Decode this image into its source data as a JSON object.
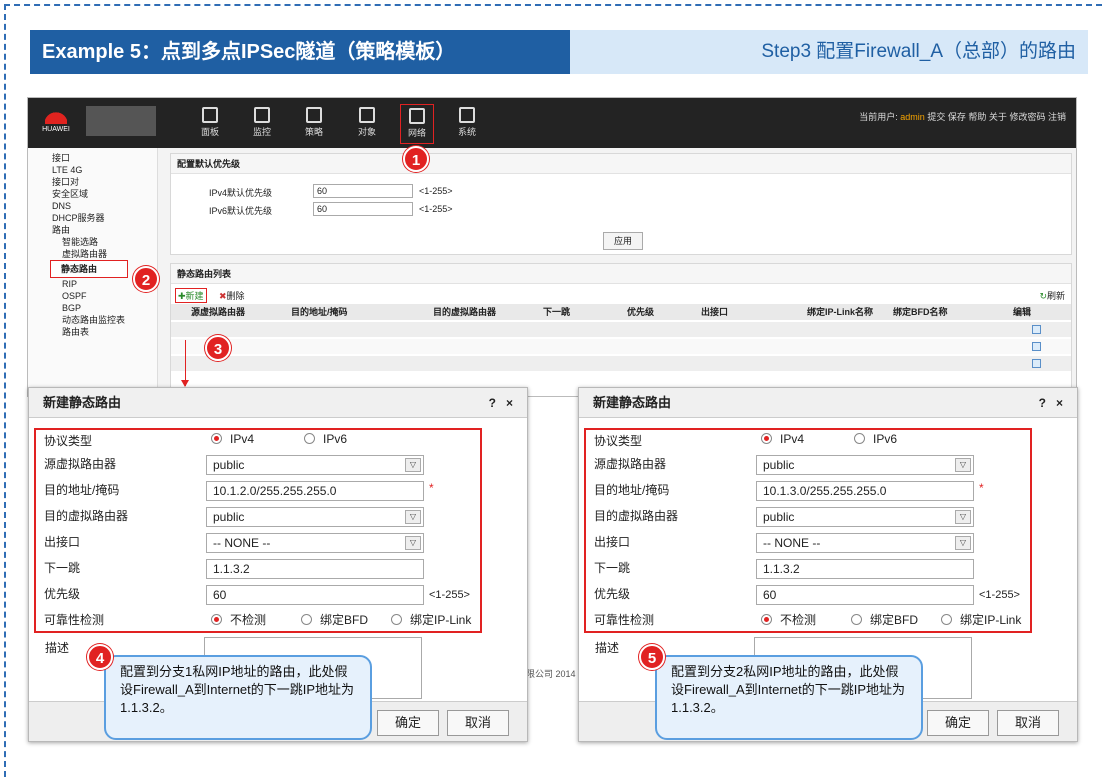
{
  "slide": {
    "title": "Example 5：点到多点IPSec隧道（策略模板）",
    "step": "Step3 配置Firewall_A（总部）的路由"
  },
  "app": {
    "logo_text": "HUAWEI",
    "nav": [
      {
        "label": "面板",
        "icon": "dashboard-icon"
      },
      {
        "label": "监控",
        "icon": "monitor-icon"
      },
      {
        "label": "策略",
        "icon": "policy-icon"
      },
      {
        "label": "对象",
        "icon": "object-icon"
      },
      {
        "label": "网络",
        "icon": "network-icon"
      },
      {
        "label": "系统",
        "icon": "system-icon"
      }
    ],
    "user_prefix": "当前用户:",
    "user": "admin",
    "user_links": [
      "提交",
      "保存",
      "帮助",
      "关于",
      "修改密码",
      "注销"
    ],
    "sidebar": [
      "接口",
      "LTE 4G",
      "接口对",
      "安全区域",
      "DNS",
      "DHCP服务器",
      "路由",
      "智能选路",
      "虚拟路由器",
      "静态路由",
      "RIP",
      "OSPF",
      "BGP",
      "动态路由监控表",
      "路由表"
    ],
    "priority_panel": {
      "title": "配置默认优先级",
      "ipv4_label": "IPv4默认优先级",
      "ipv4_value": "60",
      "ipv6_label": "IPv6默认优先级",
      "ipv6_value": "60",
      "range": "<1-255>",
      "apply": "应用"
    },
    "route_panel": {
      "title": "静态路由列表",
      "new": "新建",
      "delete": "删除",
      "refresh": "刷新",
      "columns": [
        "源虚拟路由器",
        "目的地址/掩码",
        "目的虚拟路由器",
        "下一跳",
        "优先级",
        "出接口",
        "绑定IP-Link名称",
        "绑定BFD名称",
        "编辑"
      ]
    },
    "footer_fragment": "限公司 2014"
  },
  "dialogs": [
    {
      "title": "新建静态路由",
      "help": "?",
      "close": "×",
      "protocol_label": "协议类型",
      "ipv4": "IPv4",
      "ipv6": "IPv6",
      "src_vr_label": "源虚拟路由器",
      "src_vr": "public",
      "dest_label": "目的地址/掩码",
      "dest": "10.1.2.0/255.255.255.0",
      "dest_vr_label": "目的虚拟路由器",
      "dest_vr": "public",
      "out_if_label": "出接口",
      "out_if": "-- NONE --",
      "next_hop_label": "下一跳",
      "next_hop": "1.1.3.2",
      "priority_label": "优先级",
      "priority": "60",
      "priority_range": "<1-255>",
      "check_label": "可靠性检测",
      "check_none": "不检测",
      "check_bfd": "绑定BFD",
      "check_iplink": "绑定IP-Link",
      "desc_label": "描述",
      "ok": "确定",
      "cancel": "取消",
      "callout": "配置到分支1私网IP地址的路由，此处假设Firewall_A到Internet的下一跳IP地址为1.1.3.2。"
    },
    {
      "title": "新建静态路由",
      "help": "?",
      "close": "×",
      "protocol_label": "协议类型",
      "ipv4": "IPv4",
      "ipv6": "IPv6",
      "src_vr_label": "源虚拟路由器",
      "src_vr": "public",
      "dest_label": "目的地址/掩码",
      "dest": "10.1.3.0/255.255.255.0",
      "dest_vr_label": "目的虚拟路由器",
      "dest_vr": "public",
      "out_if_label": "出接口",
      "out_if": "-- NONE --",
      "next_hop_label": "下一跳",
      "next_hop": "1.1.3.2",
      "priority_label": "优先级",
      "priority": "60",
      "priority_range": "<1-255>",
      "check_label": "可靠性检测",
      "check_none": "不检测",
      "check_bfd": "绑定BFD",
      "check_iplink": "绑定IP-Link",
      "desc_label": "描述",
      "ok": "确定",
      "cancel": "取消",
      "callout": "配置到分支2私网IP地址的路由，此处假设Firewall_A到Internet的下一跳IP地址为1.1.3.2。"
    }
  ],
  "badges": [
    "1",
    "2",
    "3",
    "4",
    "5"
  ],
  "colors": {
    "accent": "#1f5fa3",
    "highlight": "#e12222",
    "callout_border": "#5a9ee0"
  }
}
